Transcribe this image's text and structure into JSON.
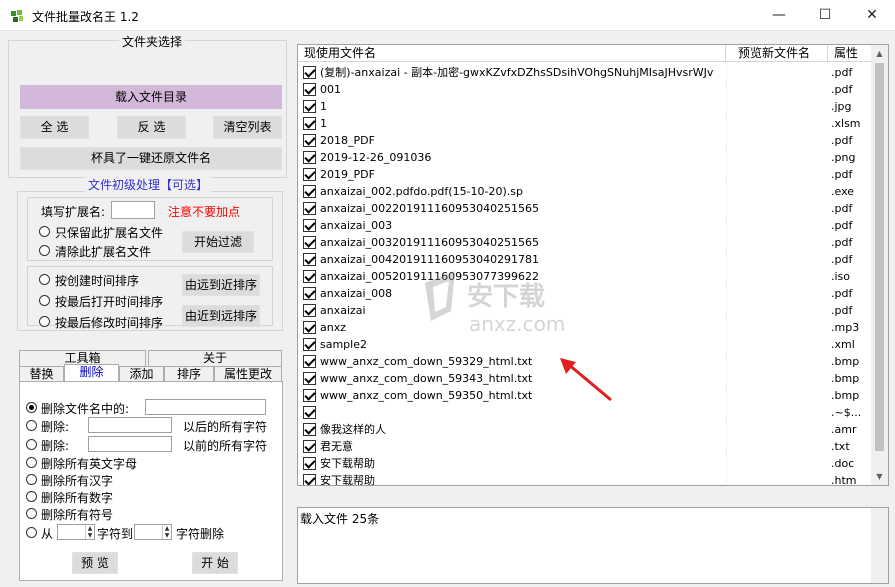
{
  "window": {
    "title": "文件批量改名王  1.2",
    "minimize_glyph": "—",
    "maximize_glyph": "☐",
    "close_glyph": "✕"
  },
  "folder_select": {
    "title": "文件夹选择",
    "load_button": "载入文件目录",
    "select_all": "全 选",
    "invert": "反 选",
    "clear_list": "清空列表",
    "restore_button": "杯具了一键还原文件名"
  },
  "initial_process": {
    "title": "文件初级处理【可选】",
    "ext_label": "填写扩展名:",
    "ext_value": "",
    "ext_warning": "注意不要加点",
    "keep_ext": "只保留此扩展名文件",
    "remove_ext": "清除此扩展名文件",
    "start_filter": "开始过滤",
    "sort_created": "按创建时间排序",
    "sort_opened": "按最后打开时间排序",
    "sort_modified": "按最后修改时间排序",
    "sort_far_near": "由远到近排序",
    "sort_near_far": "由近到远排序"
  },
  "tabs_top": [
    "工具箱",
    "关于"
  ],
  "tabs": [
    "替换",
    "删除",
    "添加",
    "排序",
    "属性更改"
  ],
  "delete_tab": {
    "opt_contains": "删除文件名中的:",
    "opt_delete_after": "删除:",
    "after_suffix": "以后的所有字符",
    "opt_delete_before": "删除:",
    "before_suffix": "以前的所有字符",
    "opt_english": "删除所有英文字母",
    "opt_chinese": "删除所有汉字",
    "opt_digits": "删除所有数字",
    "opt_symbols": "删除所有符号",
    "opt_from": "从",
    "char_to": "字符到",
    "char_delete": "字符删除",
    "preview": "预 览",
    "start": "开 始"
  },
  "list": {
    "columns": [
      "现使用文件名",
      "预览新文件名",
      "属性"
    ],
    "rows": [
      {
        "name": "(复制)-anxaizai - 副本-加密-gwxKZvfxDZhsSDsihVOhgSNuhjMIsaJHvsrWJv",
        "ext": ".pdf"
      },
      {
        "name": "001",
        "ext": ".pdf"
      },
      {
        "name": "1",
        "ext": ".jpg"
      },
      {
        "name": "1",
        "ext": ".xlsm"
      },
      {
        "name": "2018_PDF",
        "ext": ".pdf"
      },
      {
        "name": "2019-12-26_091036",
        "ext": ".png"
      },
      {
        "name": "2019_PDF",
        "ext": ".pdf"
      },
      {
        "name": "anxaizai_002.pdfdo.pdf(15-10-20).sp",
        "ext": ".exe"
      },
      {
        "name": "anxaizai_0022019111609530402515​65",
        "ext": ".pdf"
      },
      {
        "name": "anxaizai_003",
        "ext": ".pdf"
      },
      {
        "name": "anxaizai_0032019111609530402515​65",
        "ext": ".pdf"
      },
      {
        "name": "anxaizai_004201911160953040291781",
        "ext": ".pdf"
      },
      {
        "name": "anxaizai_005201911160953077399622",
        "ext": ".iso"
      },
      {
        "name": "anxaizai_008",
        "ext": ".pdf"
      },
      {
        "name": "anxaizai",
        "ext": ".pdf"
      },
      {
        "name": "anxz",
        "ext": ".mp3"
      },
      {
        "name": "sample2",
        "ext": ".xml"
      },
      {
        "name": "www_anxz_com_down_59329_html.txt",
        "ext": ".bmp"
      },
      {
        "name": "www_anxz_com_down_59343_html.txt",
        "ext": ".bmp"
      },
      {
        "name": "www_anxz_com_down_59350_html.txt",
        "ext": ".bmp"
      },
      {
        "name": "",
        "ext": ".~$..."
      },
      {
        "name": "像我这样的人",
        "ext": ".amr"
      },
      {
        "name": "君无意",
        "ext": ".txt"
      },
      {
        "name": "安下载帮助",
        "ext": ".doc"
      },
      {
        "name": "安下载帮助",
        "ext": ".htm"
      }
    ]
  },
  "log": {
    "text": "载入文件  25条"
  },
  "watermark": {
    "text": "anxz.com"
  },
  "colors": {
    "load_button": "#d3b9d9",
    "warning": "#ff0000",
    "group_title": "#3333cc",
    "arrow": "#e0201c"
  }
}
